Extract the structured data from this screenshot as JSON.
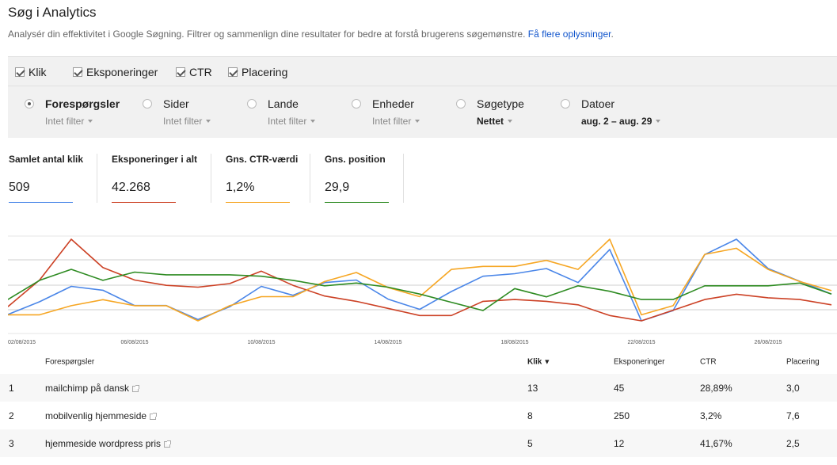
{
  "header": {
    "title": "Søg i Analytics",
    "description": "Analysér din effektivitet i Google Søgning. Filtrer og sammenlign dine resultater for bedre at forstå brugerens søgemønstre.",
    "learn_more": "Få flere oplysninger",
    "learn_more_suffix": "."
  },
  "metrics": [
    {
      "label": "Klik",
      "checked": true
    },
    {
      "label": "Eksponeringer",
      "checked": true
    },
    {
      "label": "CTR",
      "checked": true
    },
    {
      "label": "Placering",
      "checked": true
    }
  ],
  "groups": [
    {
      "label": "Forespørgsler",
      "sub": "Intet filter",
      "selected": true
    },
    {
      "label": "Sider",
      "sub": "Intet filter",
      "selected": false
    },
    {
      "label": "Lande",
      "sub": "Intet filter",
      "selected": false
    },
    {
      "label": "Enheder",
      "sub": "Intet filter",
      "selected": false
    },
    {
      "label": "Søgetype",
      "sub": "Nettet",
      "selected": false
    },
    {
      "label": "Datoer",
      "sub": "aug. 2 – aug. 29",
      "selected": false
    }
  ],
  "scorecards": [
    {
      "label": "Samlet antal klik",
      "value": "509",
      "color": "#4a86e8"
    },
    {
      "label": "Eksponeringer i alt",
      "value": "42.268",
      "color": "#cc4125"
    },
    {
      "label": "Gns. CTR-værdi",
      "value": "1,2%",
      "color": "#f6a623"
    },
    {
      "label": "Gns. position",
      "value": "29,9",
      "color": "#2e8b22"
    }
  ],
  "chart_data": {
    "type": "line",
    "x": [
      "02/08/2015",
      "03/08/2015",
      "04/08/2015",
      "05/08/2015",
      "06/08/2015",
      "07/08/2015",
      "08/08/2015",
      "09/08/2015",
      "10/08/2015",
      "11/08/2015",
      "12/08/2015",
      "13/08/2015",
      "14/08/2015",
      "15/08/2015",
      "16/08/2015",
      "17/08/2015",
      "18/08/2015",
      "19/08/2015",
      "20/08/2015",
      "21/08/2015",
      "22/08/2015",
      "23/08/2015",
      "24/08/2015",
      "25/08/2015",
      "26/08/2015",
      "27/08/2015",
      "28/08/2015"
    ],
    "xticks": [
      "02/08/2015",
      "06/08/2015",
      "10/08/2015",
      "14/08/2015",
      "18/08/2015",
      "22/08/2015",
      "26/08/2015"
    ],
    "grid": true,
    "series": [
      {
        "color": "#4a86e8",
        "values": [
          6,
          16,
          28,
          25,
          13,
          13,
          2,
          12,
          28,
          21,
          31,
          33,
          18,
          10,
          24,
          36,
          38,
          42,
          31,
          57,
          1,
          9,
          53,
          65,
          42,
          32,
          22
        ]
      },
      {
        "color": "#cc4125",
        "values": [
          2200,
          2950,
          4100,
          3300,
          2950,
          2800,
          2750,
          2850,
          3200,
          2800,
          2500,
          2350,
          2150,
          1950,
          1950,
          2350,
          2400,
          2350,
          2250,
          1950,
          1800,
          2100,
          2400,
          2550,
          2450,
          2400,
          2250
        ]
      },
      {
        "color": "#f6a623",
        "values": [
          0.5,
          0.5,
          0.8,
          1.0,
          0.8,
          0.8,
          0.3,
          0.8,
          1.1,
          1.1,
          1.6,
          1.9,
          1.4,
          1.1,
          2.0,
          2.1,
          2.1,
          2.3,
          2.0,
          3.0,
          0.5,
          0.8,
          2.5,
          2.7,
          2.0,
          1.6,
          1.3
        ]
      },
      {
        "color": "#2e8b22",
        "values": [
          34,
          27,
          23,
          27,
          24,
          25,
          25,
          25,
          25.5,
          27,
          29,
          28,
          29.5,
          32,
          35,
          38,
          30,
          33,
          29,
          31,
          34,
          34,
          29,
          29,
          29,
          28,
          32
        ]
      }
    ]
  },
  "table": {
    "headers": {
      "query": "Forespørgsler",
      "clicks": "Klik",
      "sort_arrow": "▼",
      "impressions": "Eksponeringer",
      "ctr": "CTR",
      "position": "Placering"
    },
    "rows": [
      {
        "n": "1",
        "query": "mailchimp på dansk",
        "clicks": "13",
        "impressions": "45",
        "ctr": "28,89%",
        "position": "3,0"
      },
      {
        "n": "2",
        "query": "mobilvenlig hjemmeside",
        "clicks": "8",
        "impressions": "250",
        "ctr": "3,2%",
        "position": "7,6"
      },
      {
        "n": "3",
        "query": "hjemmeside wordpress pris",
        "clicks": "5",
        "impressions": "12",
        "ctr": "41,67%",
        "position": "2,5"
      }
    ]
  }
}
